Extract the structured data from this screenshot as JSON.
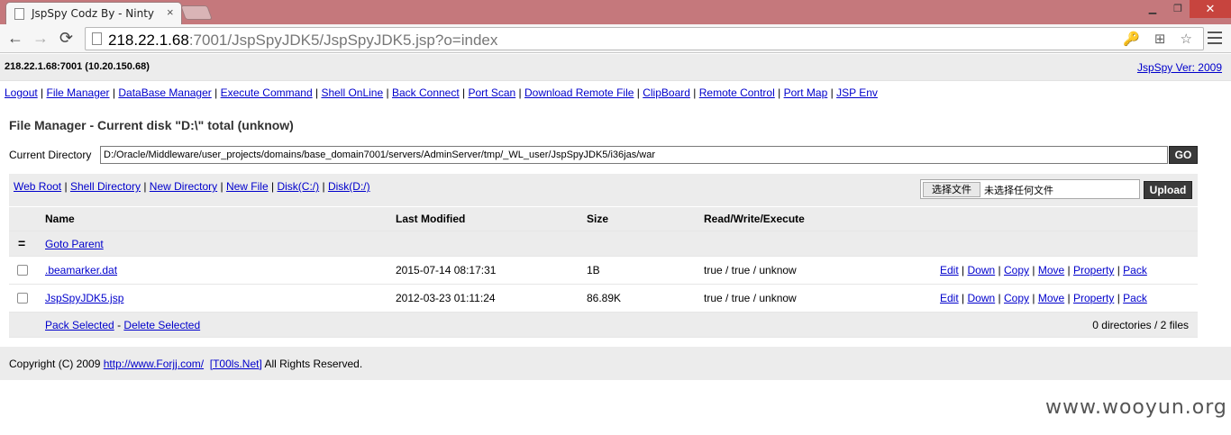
{
  "browser": {
    "tab_title": "JspSpy Codz By - Ninty",
    "tab_close": "×",
    "url_host": "218.22.1.68",
    "url_rest": ":7001/JspSpyJDK5/JspSpyJDK5.jsp?o=index",
    "window_min": "▁",
    "window_max": "❐",
    "window_close": "✕",
    "nav_back": "←",
    "nav_forward": "→",
    "nav_reload": "⟳",
    "omni_icons": "🔑 ⊞ ☆"
  },
  "header": {
    "host": "218.22.1.68:7001 (10.20.150.68)",
    "version_link": "JspSpy Ver: 2009"
  },
  "menu": [
    "Logout",
    "File Manager",
    "DataBase Manager",
    "Execute Command",
    "Shell OnLine",
    "Back Connect",
    "Port Scan",
    "Download Remote File",
    "ClipBoard",
    "Remote Control",
    "Port Map",
    "JSP Env"
  ],
  "separator": "|",
  "file_manager": {
    "title": "File Manager - Current disk \"D:\\\" total (unknow)",
    "current_dir_label": "Current Directory",
    "current_dir_value": "D:/Oracle/Middleware/user_projects/domains/base_domain7001/servers/AdminServer/tmp/_WL_user/JspSpyJDK5/i36jas/war",
    "go_label": "GO"
  },
  "quick_links": [
    "Web Root",
    "Shell Directory",
    "New Directory",
    "New File",
    "Disk(C:/)",
    "Disk(D:/)"
  ],
  "upload": {
    "choose_file_label": "选择文件",
    "no_file_text": "未选择任何文件",
    "upload_label": "Upload"
  },
  "table": {
    "headers": {
      "name": "Name",
      "modified": "Last Modified",
      "size": "Size",
      "rwx": "Read/Write/Execute"
    },
    "parent_icon": "=",
    "goto_parent": "Goto Parent",
    "files": [
      {
        "name": ".beamarker.dat",
        "modified": "2015-07-14 08:17:31",
        "size": "1B",
        "rwx": "true / true / unknow",
        "actions": [
          "Edit",
          "Down",
          "Copy",
          "Move",
          "Property",
          "Pack"
        ]
      },
      {
        "name": "JspSpyJDK5.jsp",
        "modified": "2012-03-23 01:11:24",
        "size": "86.89K",
        "rwx": "true / true / unknow",
        "actions": [
          "Edit",
          "Down",
          "Copy",
          "Move",
          "Property",
          "Pack"
        ]
      }
    ],
    "pack_selected": "Pack Selected",
    "dash": "-",
    "delete_selected": "Delete Selected",
    "count": "0 directories / 2 files"
  },
  "footer": {
    "prefix": "Copyright (C) 2009",
    "link1": "http://www.Forjj.com/",
    "link2": "[T00ls.Net]",
    "suffix": "All Rights Reserved."
  },
  "watermark": "www.wooyun.org"
}
